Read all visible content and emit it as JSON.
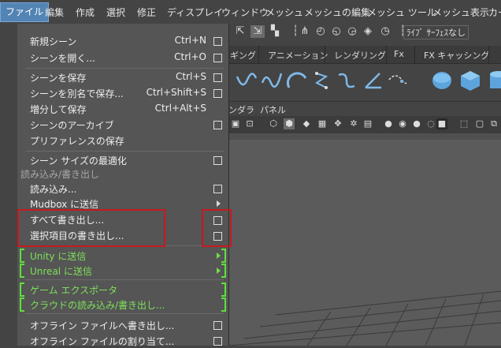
{
  "menubar": {
    "items": [
      "ファイル",
      "編集",
      "作成",
      "選択",
      "修正",
      "ディスプレイ",
      "ウィンドウ",
      "メッシュ",
      "メッシュの編集",
      "メッシュ ツール",
      "メッシュ表示",
      "カー"
    ],
    "active_index": 0
  },
  "toolbar": {
    "live_surface_label": "ﾗｲﾌﾞ ｻｰﾌｪｽなし"
  },
  "shelf_tabs": [
    "ギング",
    "アニメーション",
    "レンダリング",
    "Fx",
    "FX キャッシング"
  ],
  "panel_menu": [
    "ンダラ",
    "パネル"
  ],
  "file_menu": {
    "items": [
      {
        "label": "新規シーン",
        "shortcut": "Ctrl+N",
        "option_box": true
      },
      {
        "label": "シーンを開く...",
        "shortcut": "Ctrl+O",
        "option_box": true
      },
      {
        "label": "シーンを保存",
        "shortcut": "Ctrl+S",
        "option_box": true
      },
      {
        "label": "シーンを別名で保存...",
        "shortcut": "Ctrl+Shift+S",
        "option_box": true
      },
      {
        "label": "増分して保存",
        "shortcut": "Ctrl+Alt+S",
        "option_box": false
      },
      {
        "label": "シーンのアーカイブ",
        "shortcut": "",
        "option_box": true
      },
      {
        "label": "プリファレンスの保存",
        "shortcut": "",
        "option_box": false
      },
      {
        "label": "シーン サイズの最適化",
        "shortcut": "",
        "option_box": true
      },
      {
        "label": "読み込み...",
        "shortcut": "",
        "option_box": true
      },
      {
        "label": "Mudbox に送信",
        "shortcut": "",
        "submenu": true
      },
      {
        "label": "すべて書き出し...",
        "shortcut": "",
        "option_box": true
      },
      {
        "label": "選択項目の書き出し...",
        "shortcut": "",
        "option_box": true
      },
      {
        "label": "Unity に送信",
        "shortcut": "",
        "submenu": true
      },
      {
        "label": "Unreal に送信",
        "shortcut": "",
        "submenu": true
      },
      {
        "label": "ゲーム エクスポータ",
        "shortcut": ""
      },
      {
        "label": "クラウドの読み込み/書き出し...",
        "shortcut": ""
      },
      {
        "label": "オフライン ファイルへ書き出し...",
        "shortcut": "",
        "option_box": true
      },
      {
        "label": "オフライン ファイルの割り当て...",
        "shortcut": "",
        "option_box": true
      }
    ],
    "section_import_export": "読み込み/書き出し"
  },
  "colors": {
    "highlight_red": "#c8191e",
    "plugin_green": "#7de05a",
    "menu_bg": "#555555",
    "active_menu": "#5284b4"
  }
}
